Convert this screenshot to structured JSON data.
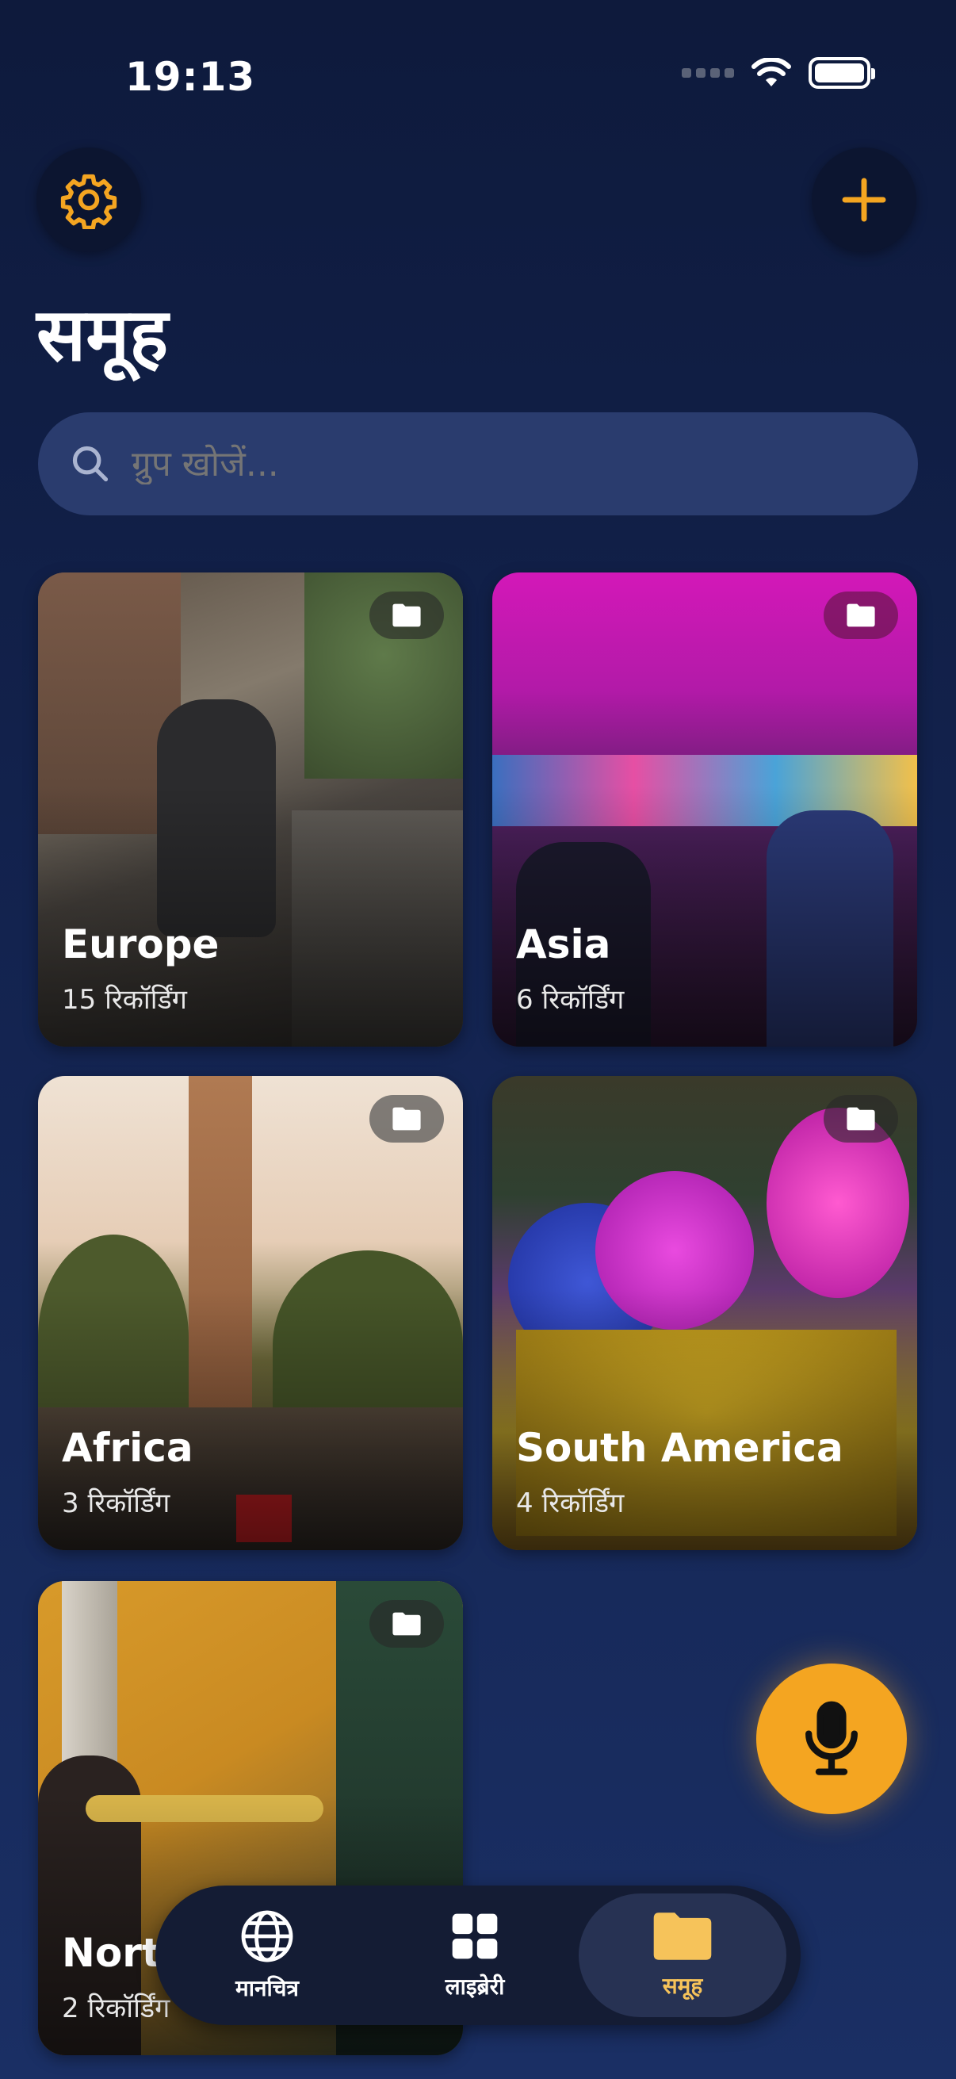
{
  "status_bar": {
    "time": "19:13"
  },
  "header": {
    "settings_icon": "gear-icon",
    "add_icon": "plus-icon",
    "title": "समूह"
  },
  "search": {
    "placeholder": "ग्रुप खोजें..."
  },
  "groups": [
    {
      "title": "Europe",
      "count": "15 रिकॉर्डिंग"
    },
    {
      "title": "Asia",
      "count": "6 रिकॉर्डिंग"
    },
    {
      "title": "Africa",
      "count": "3 रिकॉर्डिंग"
    },
    {
      "title": "South America",
      "count": "4 रिकॉर्डिंग"
    },
    {
      "title": "North",
      "count": "2 रिकॉर्डिंग"
    }
  ],
  "tabbar": {
    "tabs": [
      {
        "label": "मानचित्र",
        "icon": "globe-icon"
      },
      {
        "label": "लाइब्रेरी",
        "icon": "grid-icon"
      },
      {
        "label": "समूह",
        "icon": "folder-icon",
        "active": true
      }
    ]
  },
  "colors": {
    "accent": "#f4a521",
    "background": "#13234f",
    "active_tab_label": "#f6c35a"
  }
}
